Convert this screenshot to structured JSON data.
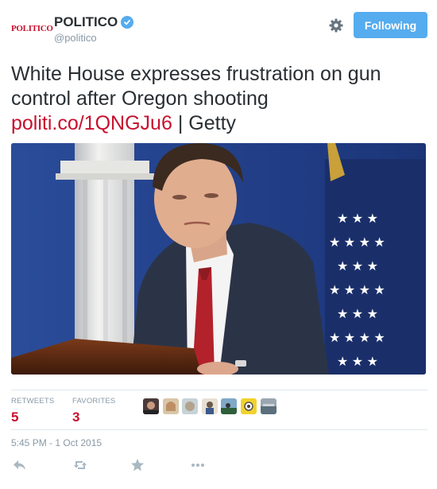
{
  "header": {
    "logo_text": "POLITICO",
    "name": "POLITICO",
    "handle": "@politico",
    "verified_icon": "verified-badge-icon",
    "settings_icon": "gear-icon",
    "follow_label": "Following",
    "accent_color": "#55acee",
    "brand_color": "#c8102e"
  },
  "tweet": {
    "text": "White House expresses frustration on gun control after Oregon shooting",
    "link": "politi.co/1QNGJu6",
    "separator": "|",
    "credit": "Getty",
    "photo_description": "photo"
  },
  "stats": {
    "retweets_label": "RETWEETS",
    "retweets_count": "5",
    "favorites_label": "FAVORITES",
    "favorites_count": "3"
  },
  "timestamp": "5:45 PM - 1 Oct 2015",
  "actions": {
    "reply_icon": "reply-icon",
    "retweet_icon": "retweet-icon",
    "favorite_icon": "star-icon",
    "more_icon": "more-icon"
  }
}
